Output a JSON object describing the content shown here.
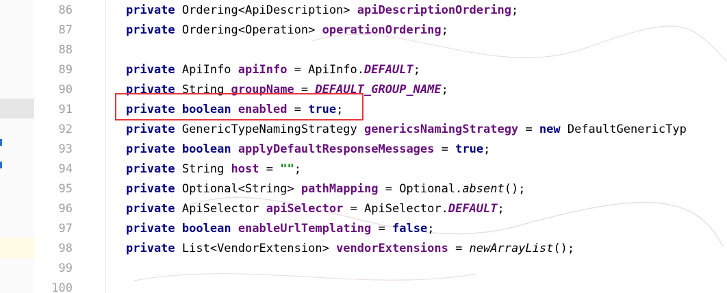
{
  "colors": {
    "keyword": "#000080",
    "field": "#660e7a",
    "string": "#008000",
    "highlight_border": "#e8353b",
    "line_number": "#a0a0a0"
  },
  "lines": [
    {
      "num": "86",
      "tokens": [
        {
          "t": "private",
          "c": "kw"
        },
        {
          "t": " Ordering<ApiDescription> "
        },
        {
          "t": "apiDescriptionOrdering",
          "c": "fld"
        },
        {
          "t": ";"
        }
      ]
    },
    {
      "num": "87",
      "tokens": [
        {
          "t": "private",
          "c": "kw"
        },
        {
          "t": " Ordering<Operation> "
        },
        {
          "t": "operationOrdering",
          "c": "fld"
        },
        {
          "t": ";"
        }
      ]
    },
    {
      "num": "88",
      "tokens": []
    },
    {
      "num": "89",
      "tokens": [
        {
          "t": "private",
          "c": "kw"
        },
        {
          "t": " ApiInfo "
        },
        {
          "t": "apiInfo",
          "c": "fld"
        },
        {
          "t": " = ApiInfo."
        },
        {
          "t": "DEFAULT",
          "c": "cst"
        },
        {
          "t": ";"
        }
      ]
    },
    {
      "num": "90",
      "tokens": [
        {
          "t": "private",
          "c": "kw"
        },
        {
          "t": " String "
        },
        {
          "t": "groupName",
          "c": "fld"
        },
        {
          "t": " = "
        },
        {
          "t": "DEFAULT_GROUP_NAME",
          "c": "cst"
        },
        {
          "t": ";"
        }
      ]
    },
    {
      "num": "91",
      "tokens": [
        {
          "t": "private",
          "c": "kw"
        },
        {
          "t": " "
        },
        {
          "t": "boolean",
          "c": "kw"
        },
        {
          "t": " "
        },
        {
          "t": "enabled",
          "c": "fld"
        },
        {
          "t": " = "
        },
        {
          "t": "true",
          "c": "kw"
        },
        {
          "t": ";"
        }
      ]
    },
    {
      "num": "92",
      "tokens": [
        {
          "t": "private",
          "c": "kw"
        },
        {
          "t": " GenericTypeNamingStrategy "
        },
        {
          "t": "genericsNamingStrategy",
          "c": "fld"
        },
        {
          "t": " = "
        },
        {
          "t": "new",
          "c": "kw"
        },
        {
          "t": " DefaultGenericTyp"
        }
      ]
    },
    {
      "num": "93",
      "tokens": [
        {
          "t": "private",
          "c": "kw"
        },
        {
          "t": " "
        },
        {
          "t": "boolean",
          "c": "kw"
        },
        {
          "t": " "
        },
        {
          "t": "applyDefaultResponseMessages",
          "c": "fld"
        },
        {
          "t": " = "
        },
        {
          "t": "true",
          "c": "kw"
        },
        {
          "t": ";"
        }
      ]
    },
    {
      "num": "94",
      "tokens": [
        {
          "t": "private",
          "c": "kw"
        },
        {
          "t": " String "
        },
        {
          "t": "host",
          "c": "fld"
        },
        {
          "t": " = "
        },
        {
          "t": "\"\"",
          "c": "str"
        },
        {
          "t": ";"
        }
      ]
    },
    {
      "num": "95",
      "tokens": [
        {
          "t": "private",
          "c": "kw"
        },
        {
          "t": " Optional<String> "
        },
        {
          "t": "pathMapping",
          "c": "fld"
        },
        {
          "t": " = Optional."
        },
        {
          "t": "absent",
          "c": "mth"
        },
        {
          "t": "();"
        }
      ]
    },
    {
      "num": "96",
      "tokens": [
        {
          "t": "private",
          "c": "kw"
        },
        {
          "t": " ApiSelector "
        },
        {
          "t": "apiSelector",
          "c": "fld"
        },
        {
          "t": " = ApiSelector."
        },
        {
          "t": "DEFAULT",
          "c": "cst"
        },
        {
          "t": ";"
        }
      ]
    },
    {
      "num": "97",
      "tokens": [
        {
          "t": "private",
          "c": "kw"
        },
        {
          "t": " "
        },
        {
          "t": "boolean",
          "c": "kw"
        },
        {
          "t": " "
        },
        {
          "t": "enableUrlTemplating",
          "c": "fld"
        },
        {
          "t": " = "
        },
        {
          "t": "false",
          "c": "kw"
        },
        {
          "t": ";"
        }
      ]
    },
    {
      "num": "98",
      "tokens": [
        {
          "t": "private",
          "c": "kw"
        },
        {
          "t": " List<VendorExtension> "
        },
        {
          "t": "vendorExtensions",
          "c": "fld"
        },
        {
          "t": " = "
        },
        {
          "t": "newArrayList",
          "c": "mth"
        },
        {
          "t": "();"
        }
      ]
    },
    {
      "num": "99",
      "tokens": []
    },
    {
      "num": "100",
      "tokens": []
    }
  ]
}
